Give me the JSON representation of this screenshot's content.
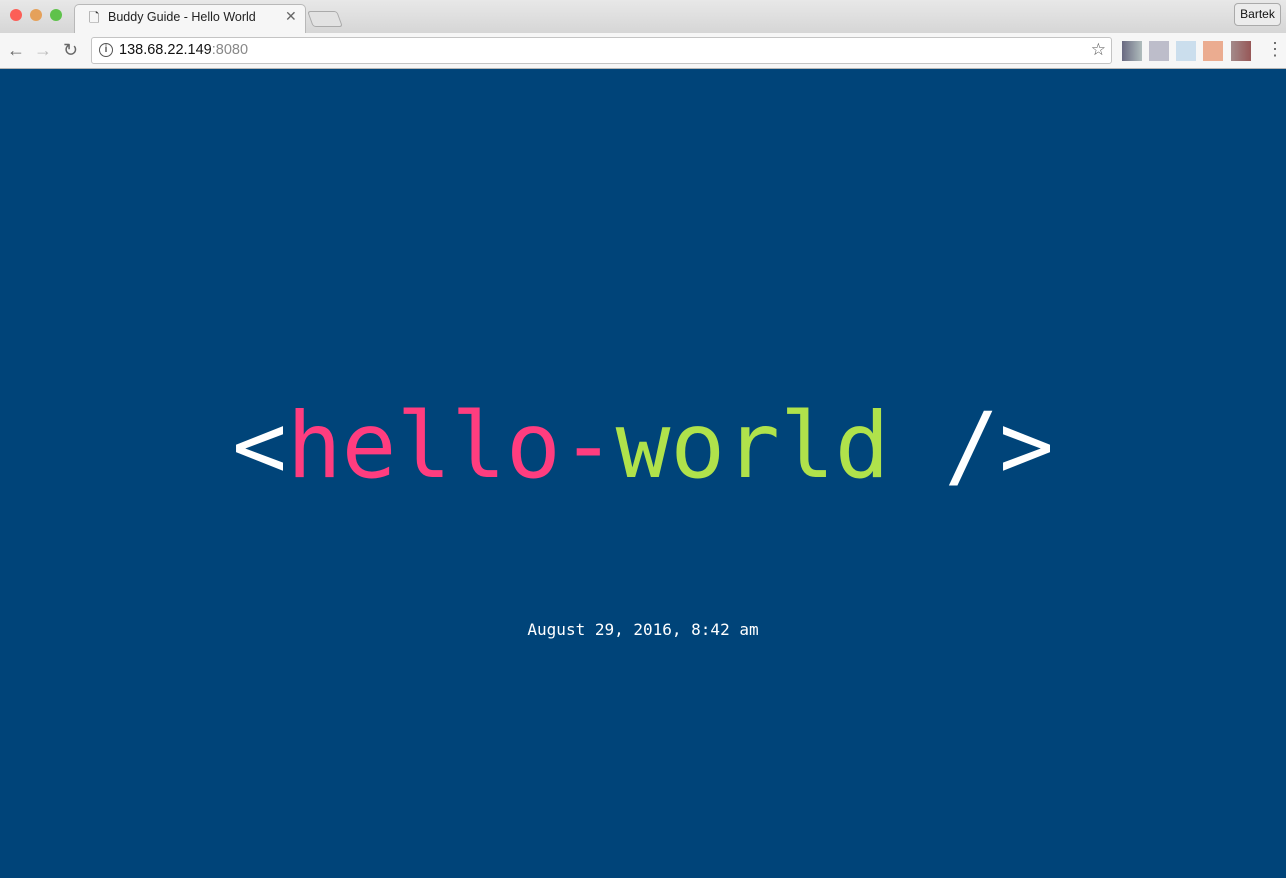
{
  "browser": {
    "tab_title": "Buddy Guide - Hello World",
    "url_host": "138.68.22.149",
    "url_port": ":8080",
    "profile_name": "Bartek"
  },
  "page": {
    "open_bracket": "<",
    "hello": "hello",
    "dash": "-",
    "world": "world",
    "close": " />",
    "date": "August 29, 2016, 8:42 am"
  },
  "colors": {
    "background": "#004479",
    "pink": "#ff3d7f",
    "green": "#b0e24b"
  }
}
